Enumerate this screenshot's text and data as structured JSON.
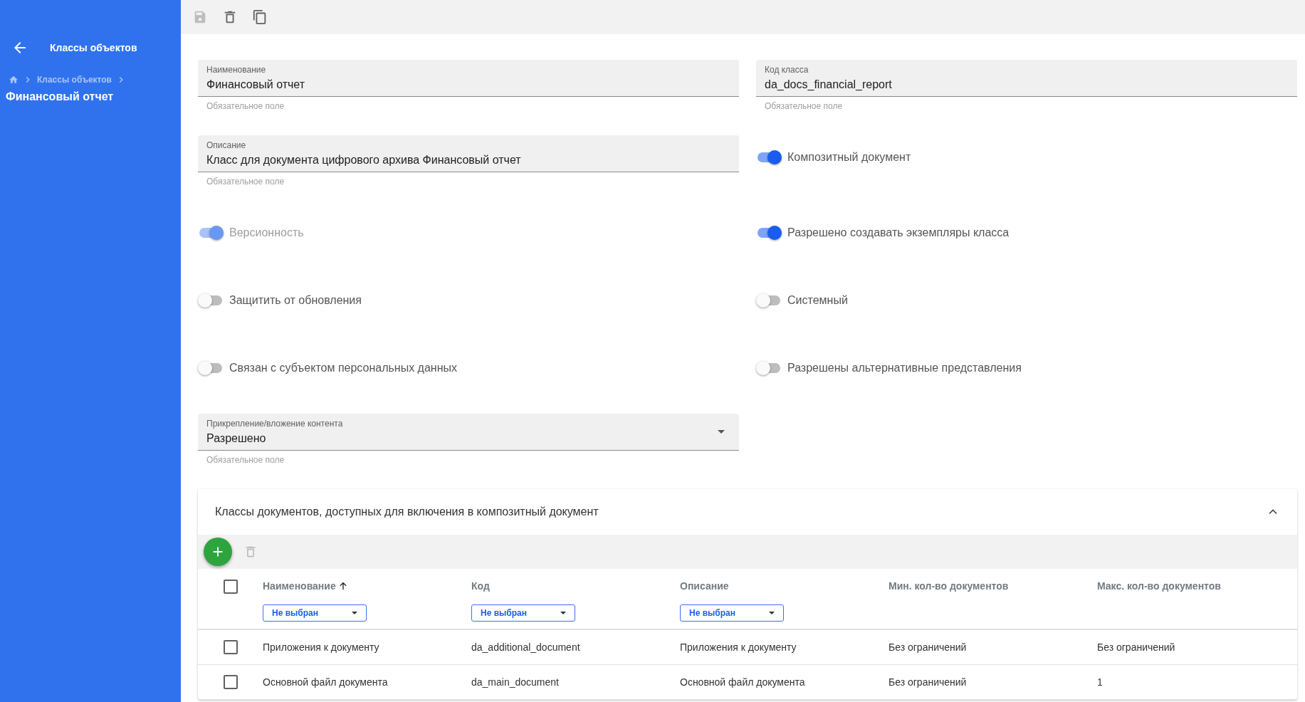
{
  "sidebar": {
    "title": "Классы объектов",
    "breadcrumb": [
      "Классы объектов"
    ],
    "current": "Финансовый отчет"
  },
  "toolbar": [
    {
      "kind": "save",
      "disabled": true
    },
    {
      "kind": "delete",
      "disabled": false
    },
    {
      "kind": "copy",
      "disabled": false
    }
  ],
  "form": [
    {
      "kind": "text",
      "label": "Наименование",
      "value": "Финансовый отчет",
      "helper": "Обязательное поле"
    },
    {
      "kind": "text",
      "label": "Код класса",
      "value": "da_docs_financial_report",
      "helper": "Обязательное поле"
    },
    {
      "kind": "text",
      "label": "Описание",
      "value": "Класс для документа цифрового архива Финансовый отчет",
      "helper": "Обязательное поле"
    },
    {
      "kind": "toggle",
      "label": "Композитный документ",
      "on": true,
      "disabled": false
    },
    {
      "kind": "toggle",
      "label": "Версионность",
      "on": true,
      "disabled": true
    },
    {
      "kind": "toggle",
      "label": "Разрешено создавать экземпляры класса",
      "on": true,
      "disabled": false
    },
    {
      "kind": "toggle",
      "label": "Защитить от обновления",
      "on": false,
      "disabled": false
    },
    {
      "kind": "toggle",
      "label": "Системный",
      "on": false,
      "disabled": false
    },
    {
      "kind": "toggle",
      "label": "Связан с субъектом персональных данных",
      "on": false,
      "disabled": false
    },
    {
      "kind": "toggle",
      "label": "Разрешены альтернативные представления",
      "on": false,
      "disabled": false
    },
    {
      "kind": "select",
      "label": "Прикрепление/вложение контента",
      "value": "Разрешено",
      "helper": "Обязательное поле"
    }
  ],
  "panel": {
    "title": "Классы документов, доступных для включения в композитный документ",
    "expanded": true,
    "toolbar": [
      {
        "kind": "add",
        "disabled": false
      },
      {
        "kind": "delete",
        "disabled": true
      }
    ],
    "table": {
      "select_all": false,
      "columns": [
        {
          "label": "Наименование",
          "sorted": true,
          "filter": "Не выбран"
        },
        {
          "label": "Код",
          "filter": "Не выбран"
        },
        {
          "label": "Описание",
          "filter": "Не выбран"
        },
        {
          "label": "Мин. кол-во документов"
        },
        {
          "label": "Макс. кол-во документов"
        }
      ],
      "rows": [
        {
          "selected": false,
          "cells": [
            "Приложения к документу",
            "da_additional_document",
            "Приложения к документу",
            "Без ограничений",
            "Без ограничений"
          ]
        },
        {
          "selected": false,
          "cells": [
            "Основной файл документа",
            "da_main_document",
            "Основной файл документа",
            "Без ограничений",
            "1"
          ]
        }
      ]
    }
  }
}
